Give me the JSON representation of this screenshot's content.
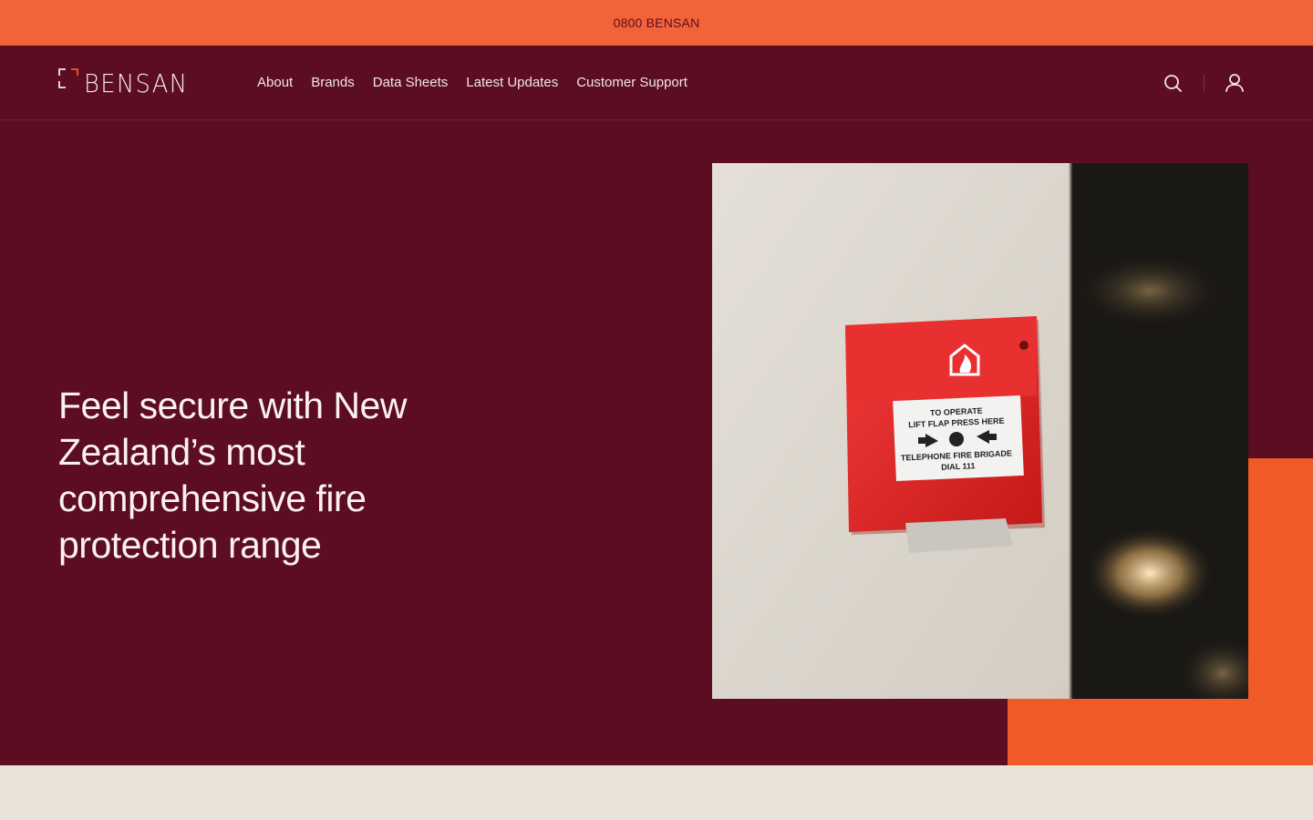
{
  "topbar": {
    "phone": "0800 BENSAN"
  },
  "header": {
    "logo_text": "BENSAN",
    "nav": [
      {
        "label": "About"
      },
      {
        "label": "Brands"
      },
      {
        "label": "Data Sheets"
      },
      {
        "label": "Latest Updates"
      },
      {
        "label": "Customer Support"
      }
    ],
    "icons": {
      "search": "search-icon",
      "account": "user-icon"
    }
  },
  "hero": {
    "headline": "Feel secure with New Zealand’s most comprehensive fire protection range",
    "image": {
      "subject": "manual-call-point-icon",
      "call_point_text": {
        "line1": "TO OPERATE",
        "line2": "LIFT FLAP PRESS HERE",
        "line3": "TELEPHONE FIRE BRIGADE",
        "line4": "DIAL 111"
      }
    }
  },
  "colors": {
    "topbar": "#f26339",
    "brand": "#5c0d22",
    "accent": "#ef5a27",
    "light_band": "#e9e3da",
    "nav_text": "#f1e6e4"
  }
}
